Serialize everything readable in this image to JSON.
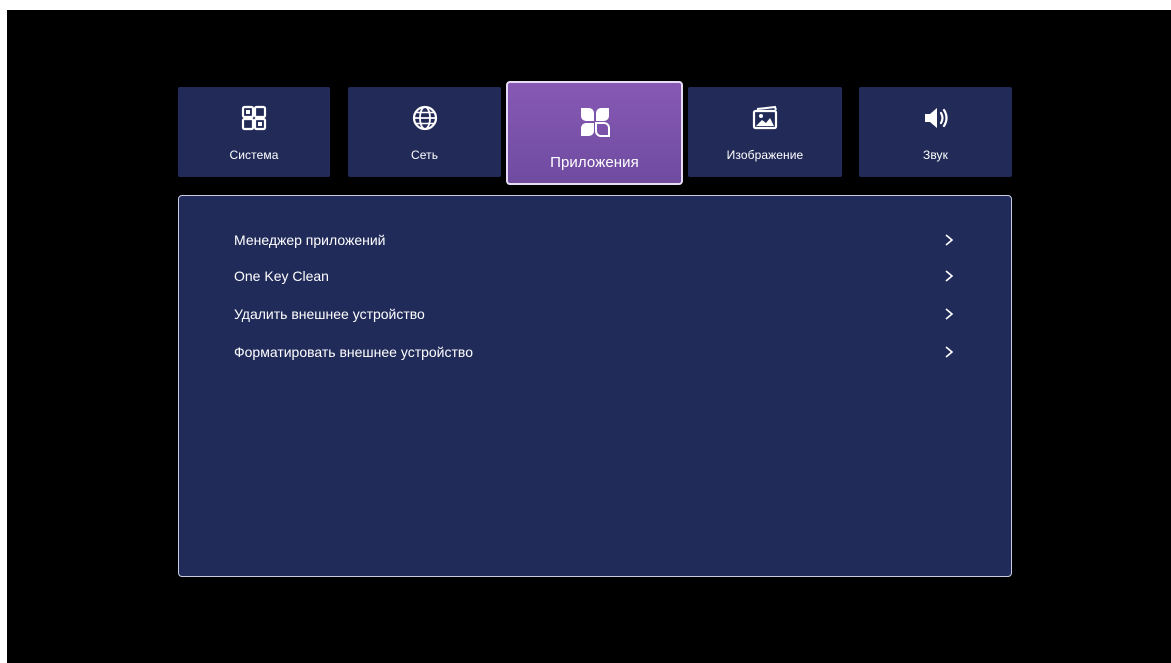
{
  "tabs": [
    {
      "label": "Система",
      "icon": "system-grid-icon",
      "active": false
    },
    {
      "label": "Сеть",
      "icon": "globe-icon",
      "active": false
    },
    {
      "label": "Приложения",
      "icon": "apps-icon",
      "active": true
    },
    {
      "label": "Изображение",
      "icon": "picture-icon",
      "active": false
    },
    {
      "label": "Звук",
      "icon": "speaker-icon",
      "active": false
    }
  ],
  "menu": {
    "items": [
      {
        "label": "Менеджер приложений",
        "icon": "chevron-right-icon"
      },
      {
        "label": "One Key Clean",
        "icon": "chevron-right-icon"
      },
      {
        "label": "Удалить внешнее устройство",
        "icon": "chevron-right-icon"
      },
      {
        "label": "Форматировать внешнее устройство",
        "icon": "chevron-right-icon"
      }
    ]
  },
  "colors": {
    "background": "#000000",
    "tab_bg": "#222b58",
    "tab_active": "#7b52aa",
    "panel_bg": "#212b5a",
    "text": "#ffffff"
  }
}
